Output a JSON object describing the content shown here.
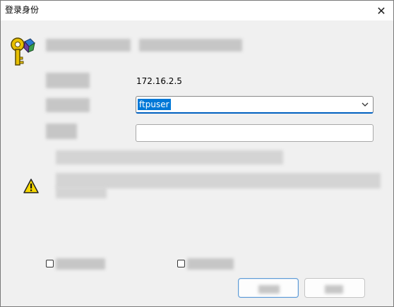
{
  "window": {
    "title": "登录身份",
    "close_glyph": "✕"
  },
  "icons": {
    "credentials": "key-icon",
    "warning": "warning-triangle-icon",
    "dropdown": "chevron-down-icon",
    "close": "close-icon"
  },
  "form": {
    "server_value": "172.16.2.5",
    "username_value": "ftpuser",
    "password_value": ""
  },
  "colors": {
    "selection": "#0078d7",
    "focus_border": "#0060c0",
    "warning_fill": "#f6d700",
    "key_gold": "#e8c000"
  }
}
